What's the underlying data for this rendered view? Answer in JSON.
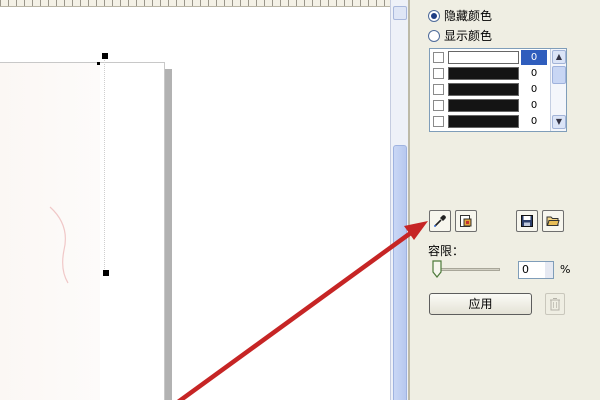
{
  "panel": {
    "radio_hide": "隐藏颜色",
    "radio_show": "显示颜色",
    "selected_radio": "hide",
    "color_rows": [
      {
        "swatch": "#ffffff",
        "value": "0",
        "selected": true
      },
      {
        "swatch": "#141414",
        "value": "0",
        "selected": false
      },
      {
        "swatch": "#141414",
        "value": "0",
        "selected": false
      },
      {
        "swatch": "#141414",
        "value": "0",
        "selected": false
      },
      {
        "swatch": "#141414",
        "value": "0",
        "selected": false
      }
    ],
    "tolerance_label": "容限：",
    "tolerance_value": "0",
    "percent": "%",
    "apply_label": "应用"
  },
  "colors": {
    "arrow": "#c62525",
    "selection": "#2f5dbd",
    "panel_bg": "#efeee3"
  }
}
